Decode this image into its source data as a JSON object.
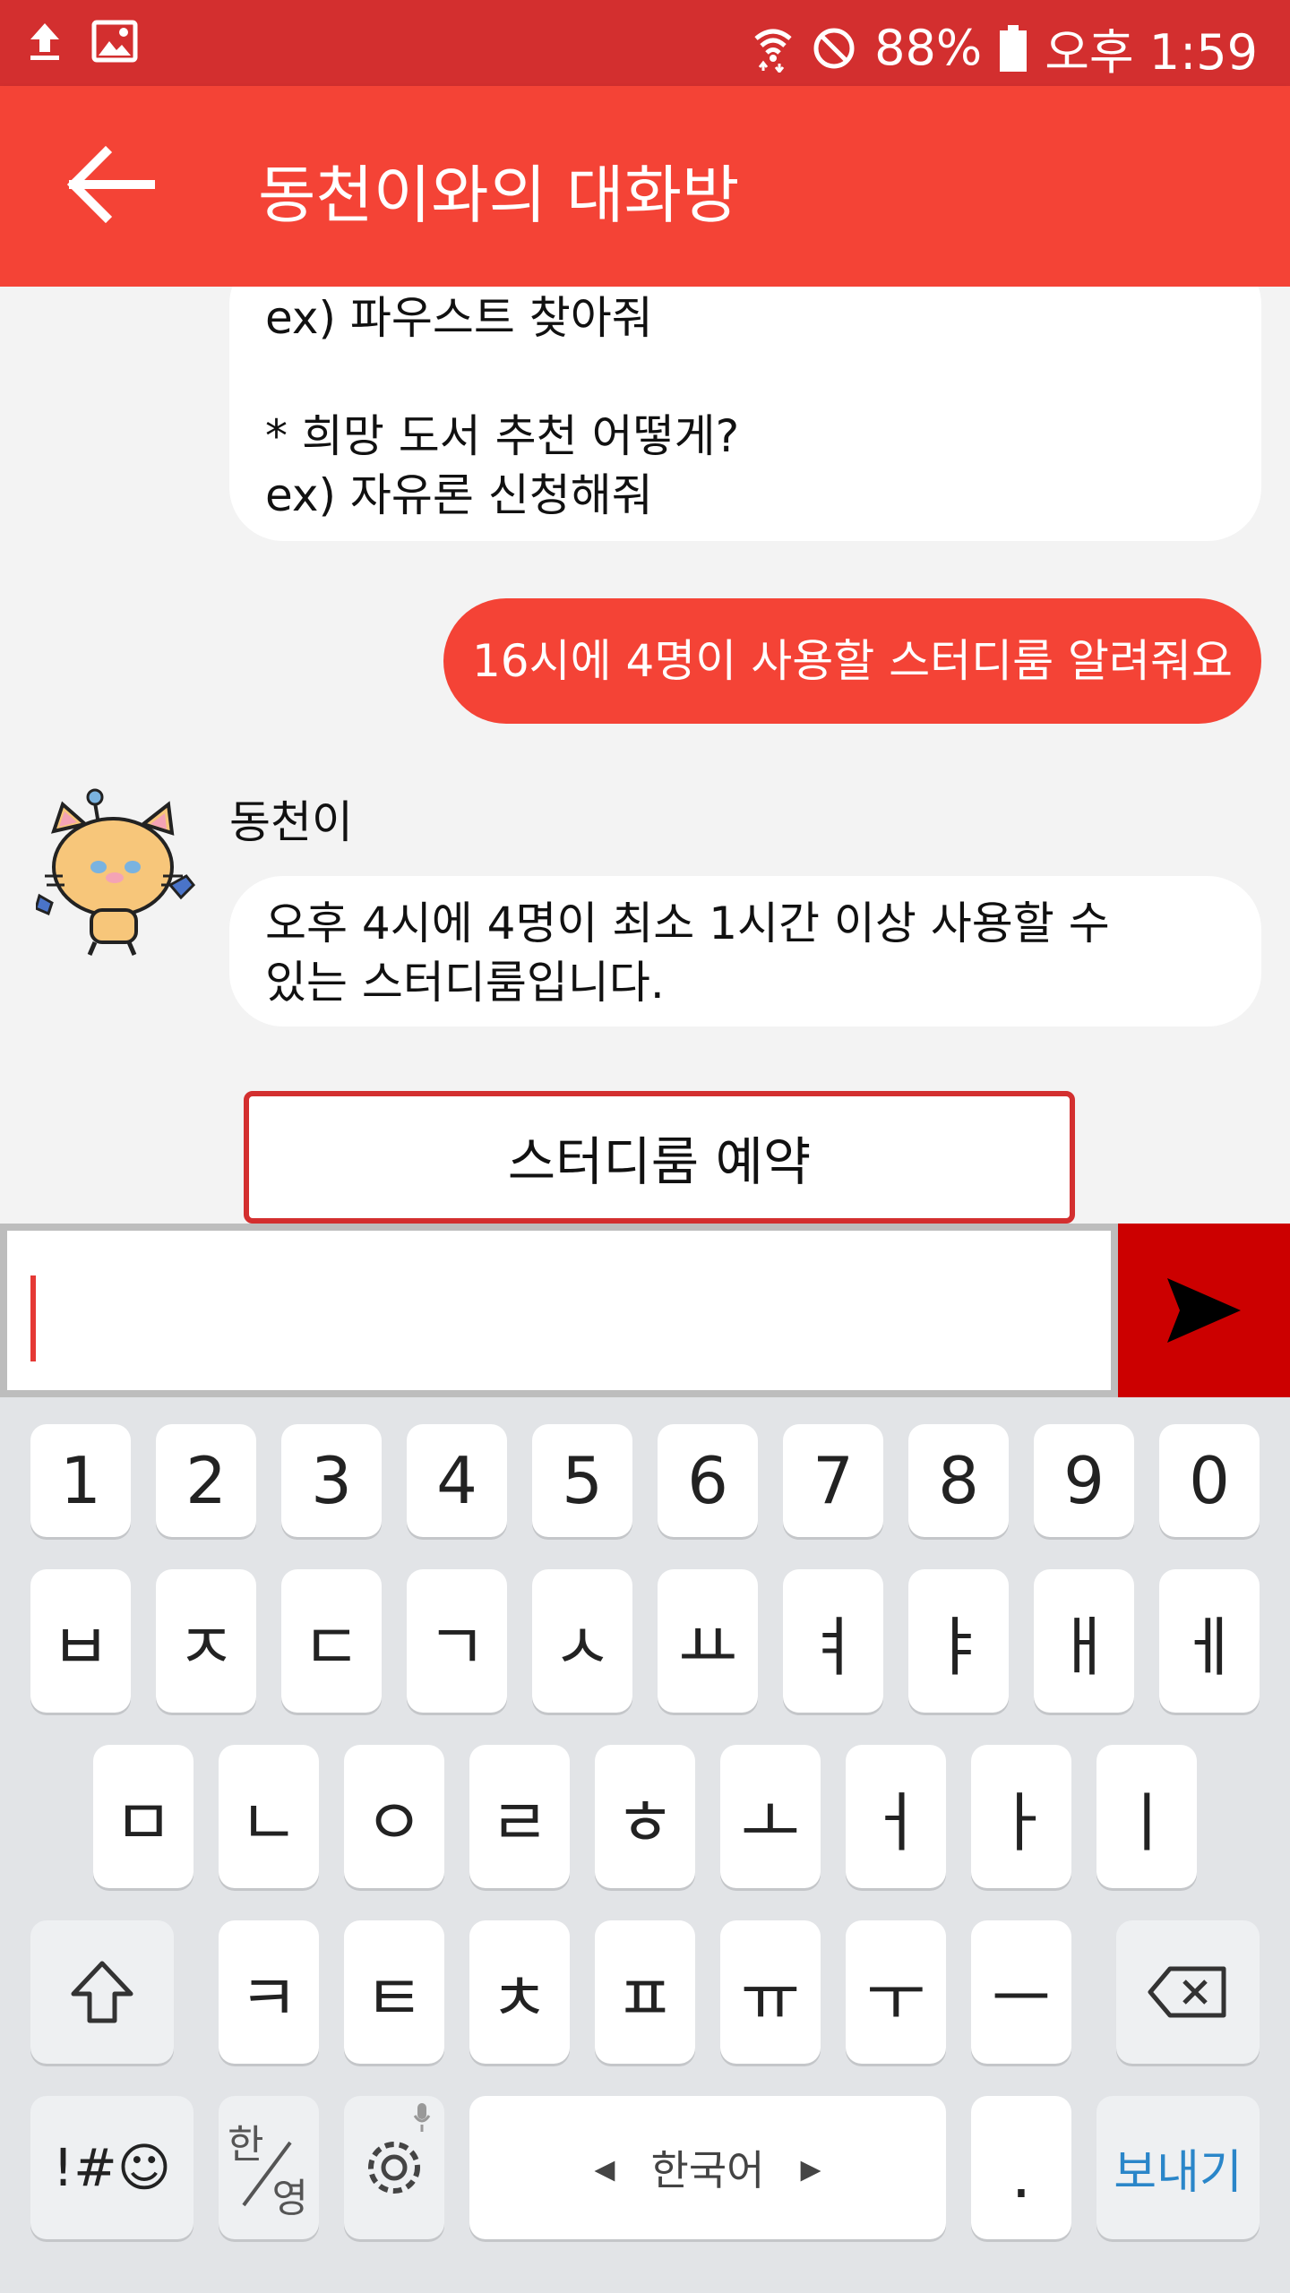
{
  "status_bar": {
    "battery": "88%",
    "time": "오후 1:59"
  },
  "app_bar": {
    "title": "동천이와의 대화방"
  },
  "chat": {
    "bot_bubble_top": [
      "ex) 파우스트 찾아줘",
      "",
      "* 희망 도서 추천 어떻게?",
      "ex) 자유론 신청해줘"
    ],
    "user_message": "16시에 4명이 사용할 스터디룸 알려줘요",
    "bot_name": "동천이",
    "bot_reply": [
      "오후 4시에 4명이 최소 1시간 이상 사용할 수",
      "있는 스터디룸입니다."
    ],
    "action_button": "스터디룸 예약"
  },
  "input": {
    "value": ""
  },
  "keyboard": {
    "row1": [
      "1",
      "2",
      "3",
      "4",
      "5",
      "6",
      "7",
      "8",
      "9",
      "0"
    ],
    "row2": [
      "ㅂ",
      "ㅈ",
      "ㄷ",
      "ㄱ",
      "ㅅ",
      "ㅛ",
      "ㅕ",
      "ㅑ",
      "ㅐ",
      "ㅔ"
    ],
    "row3": [
      "ㅁ",
      "ㄴ",
      "ㅇ",
      "ㄹ",
      "ㅎ",
      "ㅗ",
      "ㅓ",
      "ㅏ",
      "ㅣ"
    ],
    "row4": [
      "ㅋ",
      "ㅌ",
      "ㅊ",
      "ㅍ",
      "ㅠ",
      "ㅜ",
      "ㅡ"
    ],
    "symbols": "!#☺",
    "lang_top": "한",
    "lang_bottom": "영",
    "space_label": "한국어",
    "period": ".",
    "send_label": "보내기"
  },
  "colors": {
    "status_bar": "#d32f2f",
    "app_bar": "#f44336",
    "send_button": "#cc0000"
  }
}
